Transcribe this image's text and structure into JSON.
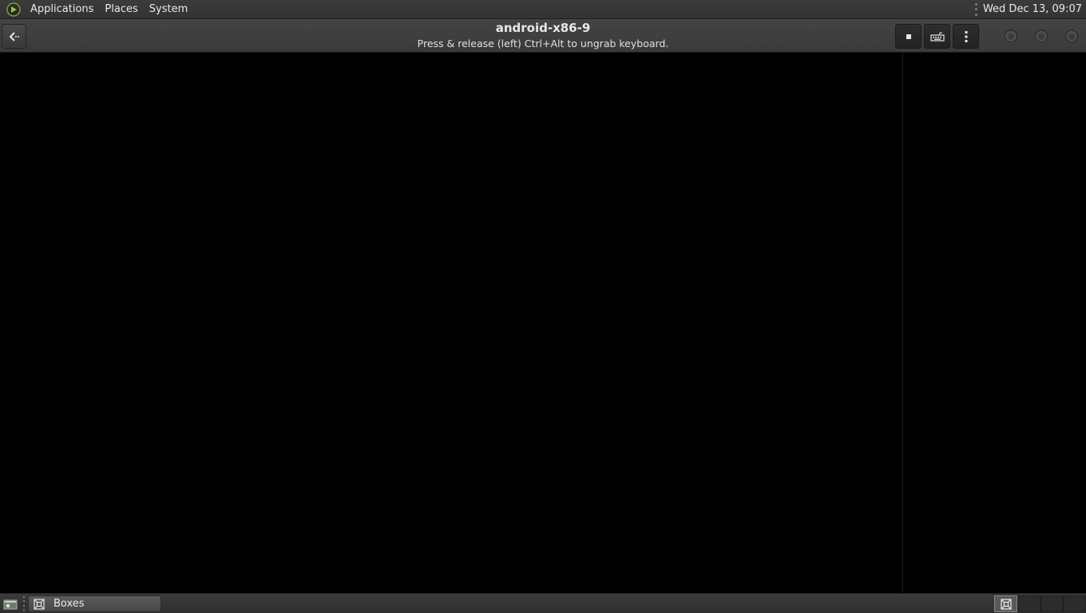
{
  "top_panel": {
    "menus": [
      "Applications",
      "Places",
      "System"
    ],
    "clock": "Wed Dec 13, 09:07",
    "logo_icon": "mate-logo-icon"
  },
  "header": {
    "title": "android-x86-9",
    "subtitle": "Press & release (left) Ctrl+Alt to ungrab keyboard.",
    "back_icon": "back-arrow-icon",
    "buttons": [
      "stop-icon",
      "keyboard-icon",
      "menu-kebab-icon"
    ],
    "window_controls": [
      "minimize",
      "maximize",
      "close"
    ]
  },
  "taskbar": {
    "show_desktop_icon": "show-desktop-icon",
    "tasks": [
      {
        "label": "Boxes",
        "icon": "boxes-app-icon"
      }
    ],
    "workspaces": 4,
    "active_workspace": 1
  },
  "colors": {
    "panel": "#3a3a3a",
    "display": "#000000",
    "accent": "#7aa33a"
  }
}
